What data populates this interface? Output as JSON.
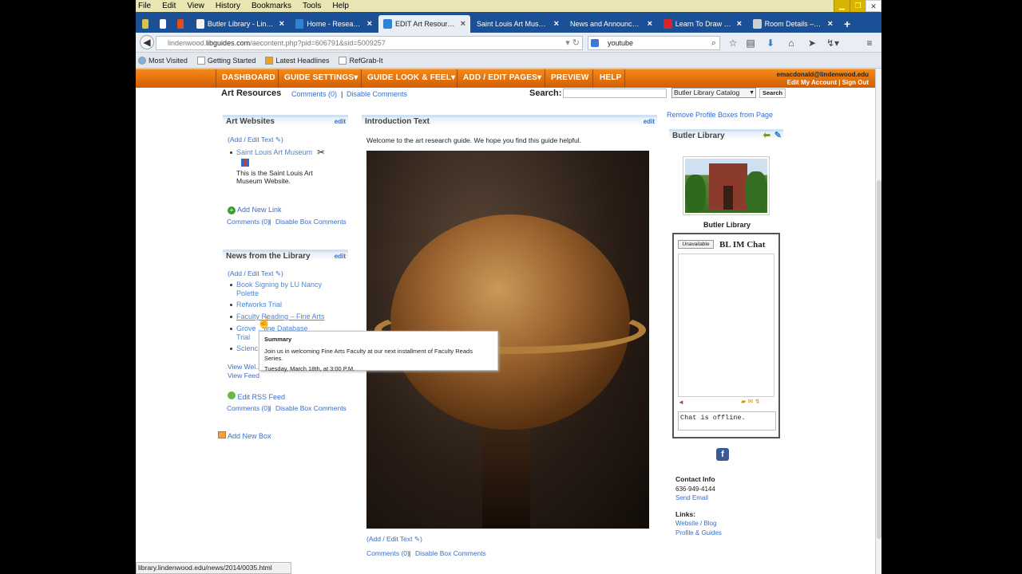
{
  "menubar": {
    "items": [
      "File",
      "Edit",
      "View",
      "History",
      "Bookmarks",
      "Tools",
      "Help"
    ]
  },
  "tabs": [
    {
      "label": "Butler Library - Lindenw...",
      "icon": "calendar-icon",
      "color": "#f2f2f2",
      "active": false
    },
    {
      "label": "Home - Research ...",
      "icon": "t-icon",
      "color": "#2f84d2",
      "active": false
    },
    {
      "label": "EDIT Art Resource...",
      "icon": "t-icon",
      "color": "#2f84d2",
      "active": true
    },
    {
      "label": "Saint Louis Art Museum",
      "icon": "none",
      "color": "",
      "active": false
    },
    {
      "label": "News and Announceme...",
      "icon": "none",
      "color": "",
      "active": false
    },
    {
      "label": "Learn To Draw - 0...",
      "icon": "youtube-icon",
      "color": "#d8242b",
      "active": false
    },
    {
      "label": "Room Details – Sa...",
      "icon": "page-icon",
      "color": "#cfcfcf",
      "active": false
    }
  ],
  "nav": {
    "url_prefix": "lindenwood.",
    "url_host": "libguides.com",
    "url_rest": "/aecontent.php?pid=606791&sid=5009257",
    "search_value": "youtube"
  },
  "bookmarks": [
    "Most Visited",
    "Getting Started",
    "Latest Headlines",
    "RefGrab-It"
  ],
  "libnav": {
    "items": [
      "DASHBOARD",
      "GUIDE SETTINGS▾",
      "GUIDE LOOK & FEEL▾",
      "ADD / EDIT PAGES▾",
      "PREVIEW",
      "HELP"
    ],
    "email": "emacdonald@lindenwood.edu",
    "edit_account": "Edit My Account",
    "sign_out": "Sign Out"
  },
  "guide": {
    "title": "Art Resources",
    "comments": "Comments (0)",
    "disable_comments": "Disable Comments",
    "search_label": "Search:",
    "search_select": "Butler Library Catalog",
    "search_button": "Search"
  },
  "left": {
    "box1_title": "Art Websites",
    "edit": "edit",
    "add_edit_text": "(Add / Edit Text",
    "link1": "Saint Louis Art Museum",
    "link1_desc_1": "This is the Saint Louis Art",
    "link1_desc_2": "Museum Website.",
    "add_new_link": "Add New Link",
    "comments": "Comments (0)",
    "disable_box_comments": "Disable Box Comments",
    "box2_title": "News from the Library",
    "news": [
      "Book Signing by LU Nancy",
      "Polette",
      "Refworks Trial",
      "Faculty Reading – Fine Arts",
      "Grove ...line Database",
      "Trial",
      "Scienc..."
    ],
    "view_web": "View Wel...",
    "view_feed": "View Feed",
    "edit_rss": "Edit RSS Feed",
    "add_new_box": "Add New Box"
  },
  "center": {
    "title": "Introduction Text",
    "edit": "edit",
    "intro": "Welcome to the art research guide. We hope you find this guide helpful.",
    "add_edit_text": "(Add / Edit Text",
    "comments": "Comments (0)",
    "disable_box_comments": "Disable Box Comments"
  },
  "tooltip": {
    "title": "Summary",
    "line1": "Join us in welcoming Fine Arts Faculty at our next installment of Faculty Reads Series.",
    "line2": "Tuesday, March 18th, at 3:00 P.M."
  },
  "right": {
    "remove_profile": "Remove Profile Boxes from Page",
    "box_title": "Butler Library",
    "caption": "Butler Library",
    "chat_status_btn": "Unavailable",
    "chat_title": "BL IM Chat",
    "chat_offline": "Chat is offline.",
    "contact_label": "Contact Info",
    "phone": "636-949-4144",
    "send_email": "Send Email",
    "links_label": "Links:",
    "link_web": "Website / Blog",
    "link_profile": "Profile & Guides"
  },
  "status_text": "library.lindenwood.edu/news/2014/0035.html"
}
